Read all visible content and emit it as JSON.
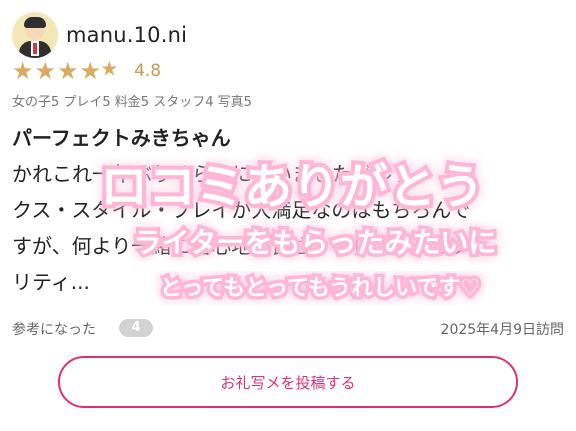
{
  "user": {
    "name": "manu.10.ni",
    "rating": 4.8,
    "rating_text": "4.8",
    "stars_display": 4.5
  },
  "subscores_text": "女の子5 プレイ5 料金5 スタッフ4 写真5",
  "review": {
    "title": "パーフェクトみきちゃん",
    "body_lines": [
      "かれこれ一年ぶりくらいに会いましたがルッ",
      "クス・スタイル・プレイが大満足なのはもちろんで",
      "すが、何より一緒に居心地の良さ、そしてホスピタ",
      "リティ..."
    ]
  },
  "footer": {
    "helpful_label": "参考になった",
    "helpful_count": "4",
    "visit_date": "2025年4月9日訪問"
  },
  "cta_label": "お礼写メを投稿する",
  "overlay_stamp": {
    "line1": "ロコミありがとう",
    "line2": "ライターをもらったみたいに",
    "line3": "とってもとってもうれしいです♡",
    "color": "#ffb6d6"
  },
  "colors": {
    "accent": "#df2f78",
    "star": "#d8aa62",
    "badge": "#d2d2d2"
  }
}
